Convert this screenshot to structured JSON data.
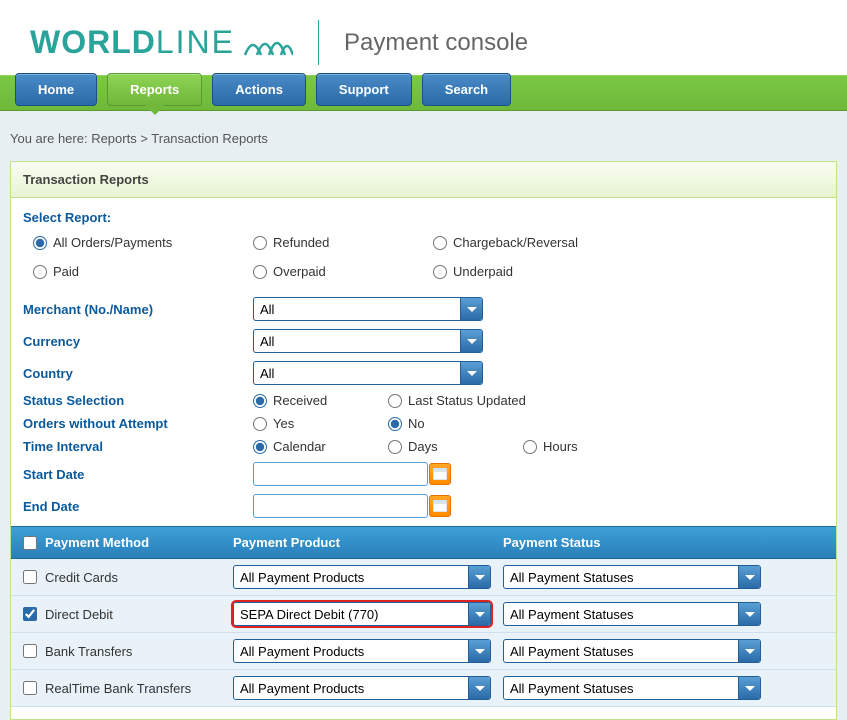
{
  "logo": {
    "text1": "WORLD",
    "text2": "LINE",
    "subtitle": "Payment console"
  },
  "nav": {
    "home": "Home",
    "reports": "Reports",
    "actions": "Actions",
    "support": "Support",
    "search": "Search"
  },
  "breadcrumb": "You are here: Reports > Transaction Reports",
  "panel_title": "Transaction Reports",
  "select_report_label": "Select Report:",
  "radios": {
    "all_orders": "All Orders/Payments",
    "refunded": "Refunded",
    "chargeback": "Chargeback/Reversal",
    "paid": "Paid",
    "overpaid": "Overpaid",
    "underpaid": "Underpaid"
  },
  "labels": {
    "merchant": "Merchant (No./Name)",
    "currency": "Currency",
    "country": "Country",
    "status_selection": "Status Selection",
    "orders_without_attempt": "Orders without Attempt",
    "time_interval": "Time Interval",
    "start_date": "Start Date",
    "end_date": "End Date"
  },
  "selects": {
    "merchant": "All",
    "currency": "All",
    "country": "All"
  },
  "status_sel": {
    "received": "Received",
    "last_updated": "Last Status Updated"
  },
  "attempt": {
    "yes": "Yes",
    "no": "No"
  },
  "interval": {
    "calendar": "Calendar",
    "days": "Days",
    "hours": "Hours"
  },
  "table": {
    "headers": {
      "payment_method": "Payment Method",
      "payment_product": "Payment Product",
      "payment_status": "Payment Status"
    },
    "rows": [
      {
        "method": "Credit Cards",
        "product": "All Payment Products",
        "status": "All Payment Statuses",
        "checked": false,
        "highlighted": false
      },
      {
        "method": "Direct Debit",
        "product": "SEPA Direct Debit (770)",
        "status": "All Payment Statuses",
        "checked": true,
        "highlighted": true
      },
      {
        "method": "Bank Transfers",
        "product": "All Payment Products",
        "status": "All Payment Statuses",
        "checked": false,
        "highlighted": false
      },
      {
        "method": "RealTime Bank Transfers",
        "product": "All Payment Products",
        "status": "All Payment Statuses",
        "checked": false,
        "highlighted": false
      }
    ]
  }
}
